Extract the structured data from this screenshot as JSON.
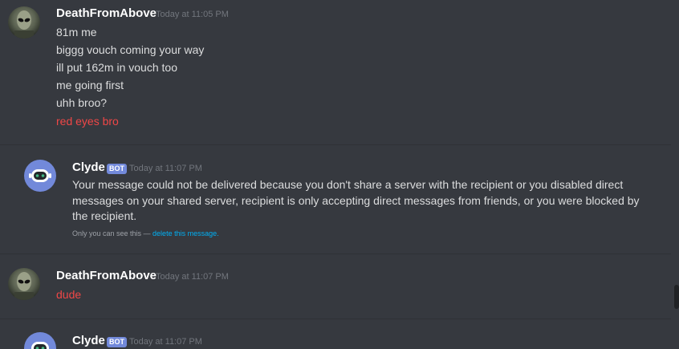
{
  "messages": [
    {
      "author": "DeathFromAbove",
      "timestamp": "Today at 11:05 PM",
      "lines": [
        "81m me",
        "biggg vouch coming your way",
        "ill put 162m in vouch too",
        "me going first",
        "uhh broo?"
      ],
      "red_line": "red eyes bro"
    },
    {
      "author": "Clyde",
      "badge": "BOT",
      "timestamp": "Today at 11:07 PM",
      "text": "Your message could not be delivered because you don't share a server with the recipient or you disabled direct messages on your shared server, recipient is only accepting direct messages from friends, or you were blocked by the recipient.",
      "notice_prefix": "Only you can see this — ",
      "notice_link": "delete this message."
    },
    {
      "author": "DeathFromAbove",
      "timestamp": "Today at 11:07 PM",
      "red_line": "dude"
    },
    {
      "author": "Clyde",
      "badge": "BOT",
      "timestamp": "Today at 11:07 PM"
    }
  ],
  "colors": {
    "background": "#36393f",
    "red_text": "#f04747",
    "bot_badge": "#7289da",
    "link": "#00b0f4"
  }
}
